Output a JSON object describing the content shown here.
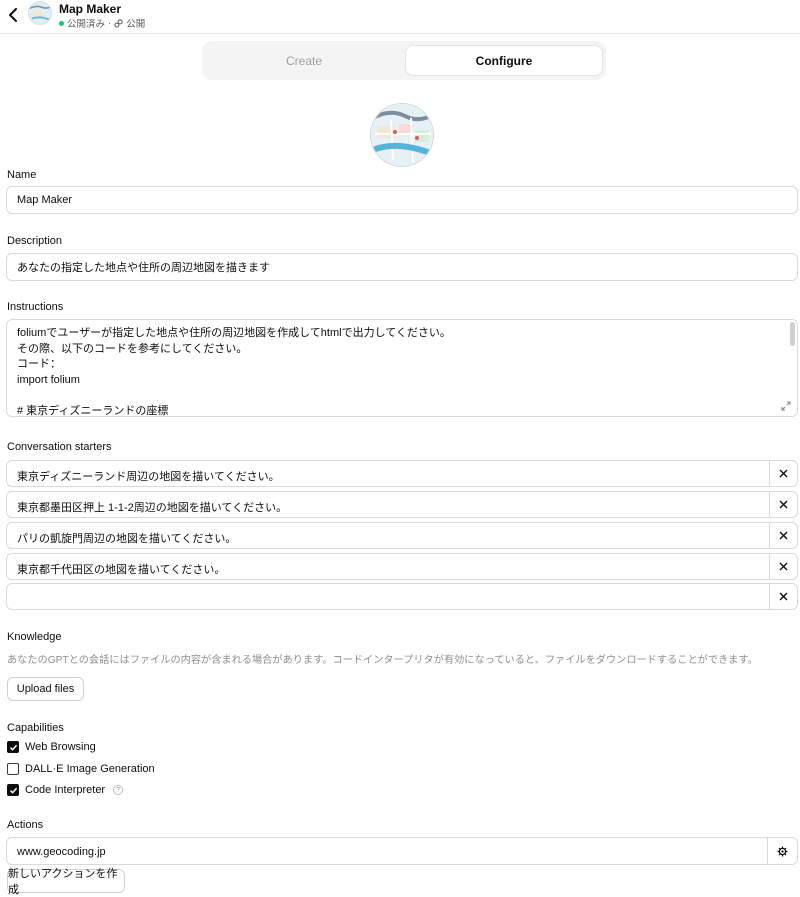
{
  "header": {
    "title": "Map Maker",
    "status": "公開済み",
    "separator": "·",
    "visibility": "公開",
    "back_icon": "chevron-left-icon",
    "link_icon": "link-icon"
  },
  "tabs": [
    {
      "label": "Create",
      "active": false
    },
    {
      "label": "Configure",
      "active": true
    }
  ],
  "form": {
    "name_label": "Name",
    "name_value": "Map Maker",
    "description_label": "Description",
    "description_value": "あなたの指定した地点や住所の周辺地図を描きます",
    "instructions_label": "Instructions",
    "instructions_lines": [
      "foliumでユーザーが指定した地点や住所の周辺地図を作成してhtmlで出力してください。",
      "その際、以下のコードを参考にしてください。",
      "コード：",
      "import folium",
      "",
      "# 東京ディズニーランドの座標"
    ],
    "starters_label": "Conversation starters",
    "starters": [
      "東京ディズニーランド周辺の地図を描いてください。",
      " 東京都墨田区押上 1-1-2周辺の地図を描いてください。",
      "パリの凱旋門周辺の地図を描いてください。",
      "東京都千代田区の地図を描いてください。",
      ""
    ],
    "knowledge_label": "Knowledge",
    "knowledge_desc": "あなたのGPTとの会話にはファイルの内容が含まれる場合があります。コードインタープリタが有効になっていると、ファイルをダウンロードすることができます。",
    "upload_label": "Upload files",
    "capabilities_label": "Capabilities",
    "capabilities": [
      {
        "label": "Web Browsing",
        "checked": true
      },
      {
        "label": "DALL·E Image Generation",
        "checked": false
      },
      {
        "label": "Code Interpreter",
        "checked": true,
        "info": "?"
      }
    ],
    "actions_label": "Actions",
    "actions": [
      {
        "label": "www.geocoding.jp"
      }
    ],
    "new_action_label": "新しいアクションを作成"
  },
  "colors": {
    "accent": "#0d0d0d",
    "status_dot": "#19c37d",
    "border": "#d9d9d9",
    "muted": "#8e8e8e"
  }
}
